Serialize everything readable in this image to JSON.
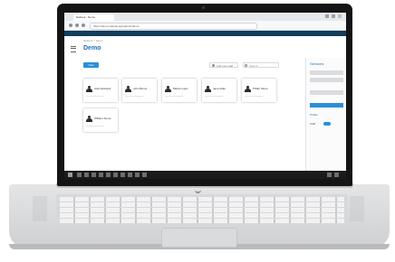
{
  "browser": {
    "tab_title": "Nabook - Demo",
    "url": "https://demo.nabook.app/admin/demo"
  },
  "app": {
    "breadcrumb": "Nabook > Demo",
    "title": "Demo",
    "new_button": "New",
    "add_button": "Add new staff",
    "search_placeholder": "Search"
  },
  "staff_cards": [
    {
      "name": "Administrador"
    },
    {
      "name": "John Burns"
    },
    {
      "name": "Marta Lopez"
    },
    {
      "name": "Jane Adler"
    },
    {
      "name": "Phillip Stone"
    },
    {
      "name": "William Stone"
    }
  ],
  "side_panel": {
    "title": "Services",
    "section": "Profile",
    "toggle_label": "Staff"
  },
  "colors": {
    "brand": "#1e6fb5",
    "accent": "#2b8fd6",
    "appbar": "#123d5c"
  }
}
